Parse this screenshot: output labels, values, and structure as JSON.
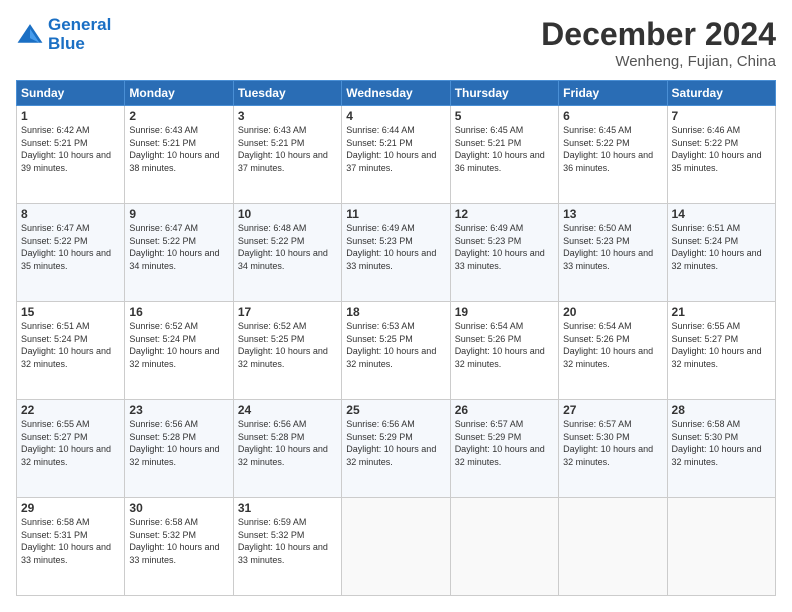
{
  "header": {
    "logo_line1": "General",
    "logo_line2": "Blue",
    "month_title": "December 2024",
    "location": "Wenheng, Fujian, China"
  },
  "weekdays": [
    "Sunday",
    "Monday",
    "Tuesday",
    "Wednesday",
    "Thursday",
    "Friday",
    "Saturday"
  ],
  "weeks": [
    [
      {
        "day": "1",
        "sunrise": "6:42 AM",
        "sunset": "5:21 PM",
        "daylight": "10 hours and 39 minutes."
      },
      {
        "day": "2",
        "sunrise": "6:43 AM",
        "sunset": "5:21 PM",
        "daylight": "10 hours and 38 minutes."
      },
      {
        "day": "3",
        "sunrise": "6:43 AM",
        "sunset": "5:21 PM",
        "daylight": "10 hours and 37 minutes."
      },
      {
        "day": "4",
        "sunrise": "6:44 AM",
        "sunset": "5:21 PM",
        "daylight": "10 hours and 37 minutes."
      },
      {
        "day": "5",
        "sunrise": "6:45 AM",
        "sunset": "5:21 PM",
        "daylight": "10 hours and 36 minutes."
      },
      {
        "day": "6",
        "sunrise": "6:45 AM",
        "sunset": "5:22 PM",
        "daylight": "10 hours and 36 minutes."
      },
      {
        "day": "7",
        "sunrise": "6:46 AM",
        "sunset": "5:22 PM",
        "daylight": "10 hours and 35 minutes."
      }
    ],
    [
      {
        "day": "8",
        "sunrise": "6:47 AM",
        "sunset": "5:22 PM",
        "daylight": "10 hours and 35 minutes."
      },
      {
        "day": "9",
        "sunrise": "6:47 AM",
        "sunset": "5:22 PM",
        "daylight": "10 hours and 34 minutes."
      },
      {
        "day": "10",
        "sunrise": "6:48 AM",
        "sunset": "5:22 PM",
        "daylight": "10 hours and 34 minutes."
      },
      {
        "day": "11",
        "sunrise": "6:49 AM",
        "sunset": "5:23 PM",
        "daylight": "10 hours and 33 minutes."
      },
      {
        "day": "12",
        "sunrise": "6:49 AM",
        "sunset": "5:23 PM",
        "daylight": "10 hours and 33 minutes."
      },
      {
        "day": "13",
        "sunrise": "6:50 AM",
        "sunset": "5:23 PM",
        "daylight": "10 hours and 33 minutes."
      },
      {
        "day": "14",
        "sunrise": "6:51 AM",
        "sunset": "5:24 PM",
        "daylight": "10 hours and 32 minutes."
      }
    ],
    [
      {
        "day": "15",
        "sunrise": "6:51 AM",
        "sunset": "5:24 PM",
        "daylight": "10 hours and 32 minutes."
      },
      {
        "day": "16",
        "sunrise": "6:52 AM",
        "sunset": "5:24 PM",
        "daylight": "10 hours and 32 minutes."
      },
      {
        "day": "17",
        "sunrise": "6:52 AM",
        "sunset": "5:25 PM",
        "daylight": "10 hours and 32 minutes."
      },
      {
        "day": "18",
        "sunrise": "6:53 AM",
        "sunset": "5:25 PM",
        "daylight": "10 hours and 32 minutes."
      },
      {
        "day": "19",
        "sunrise": "6:54 AM",
        "sunset": "5:26 PM",
        "daylight": "10 hours and 32 minutes."
      },
      {
        "day": "20",
        "sunrise": "6:54 AM",
        "sunset": "5:26 PM",
        "daylight": "10 hours and 32 minutes."
      },
      {
        "day": "21",
        "sunrise": "6:55 AM",
        "sunset": "5:27 PM",
        "daylight": "10 hours and 32 minutes."
      }
    ],
    [
      {
        "day": "22",
        "sunrise": "6:55 AM",
        "sunset": "5:27 PM",
        "daylight": "10 hours and 32 minutes."
      },
      {
        "day": "23",
        "sunrise": "6:56 AM",
        "sunset": "5:28 PM",
        "daylight": "10 hours and 32 minutes."
      },
      {
        "day": "24",
        "sunrise": "6:56 AM",
        "sunset": "5:28 PM",
        "daylight": "10 hours and 32 minutes."
      },
      {
        "day": "25",
        "sunrise": "6:56 AM",
        "sunset": "5:29 PM",
        "daylight": "10 hours and 32 minutes."
      },
      {
        "day": "26",
        "sunrise": "6:57 AM",
        "sunset": "5:29 PM",
        "daylight": "10 hours and 32 minutes."
      },
      {
        "day": "27",
        "sunrise": "6:57 AM",
        "sunset": "5:30 PM",
        "daylight": "10 hours and 32 minutes."
      },
      {
        "day": "28",
        "sunrise": "6:58 AM",
        "sunset": "5:30 PM",
        "daylight": "10 hours and 32 minutes."
      }
    ],
    [
      {
        "day": "29",
        "sunrise": "6:58 AM",
        "sunset": "5:31 PM",
        "daylight": "10 hours and 33 minutes."
      },
      {
        "day": "30",
        "sunrise": "6:58 AM",
        "sunset": "5:32 PM",
        "daylight": "10 hours and 33 minutes."
      },
      {
        "day": "31",
        "sunrise": "6:59 AM",
        "sunset": "5:32 PM",
        "daylight": "10 hours and 33 minutes."
      },
      null,
      null,
      null,
      null
    ]
  ]
}
